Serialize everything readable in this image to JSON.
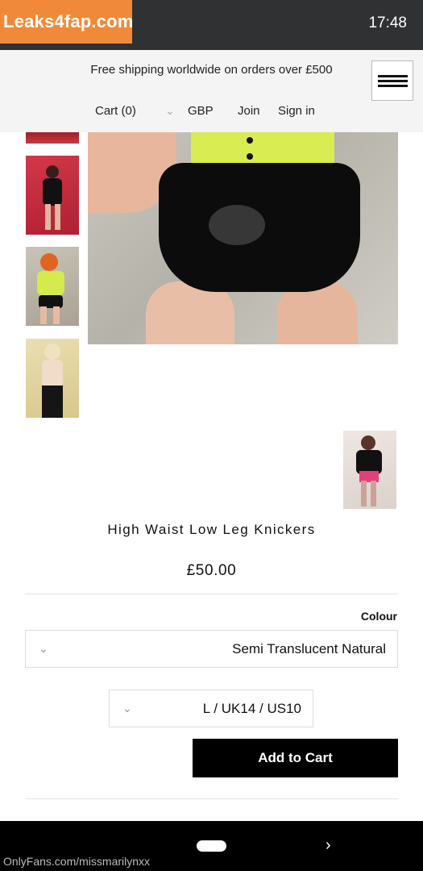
{
  "status_bar": {
    "watermark": "Leaks4fap.com",
    "time": "17:48"
  },
  "header": {
    "shipping_banner": "Free shipping worldwide on orders over £500",
    "menu_icon": "hamburger-menu-icon",
    "nav": {
      "sign_in": "Sign in",
      "join": "Join",
      "currency": "GBP",
      "cart": "Cart (0)"
    }
  },
  "product": {
    "title": "High Waist Low Leg Knickers",
    "price": "£50.00",
    "colour_label": "Colour",
    "colour_selected": "Semi Translucent Natural",
    "size_selected": "L / UK14 / US10",
    "add_to_cart_label": "Add to Cart"
  },
  "bottom_bar": {
    "watermark_url": "OnlyFans.com/missmarilynxx"
  },
  "colors": {
    "status_bar_bg": "#2f3132",
    "logo_bg": "#f08a3a",
    "header_bg": "#f4f4f4",
    "button_bg": "#000000"
  }
}
